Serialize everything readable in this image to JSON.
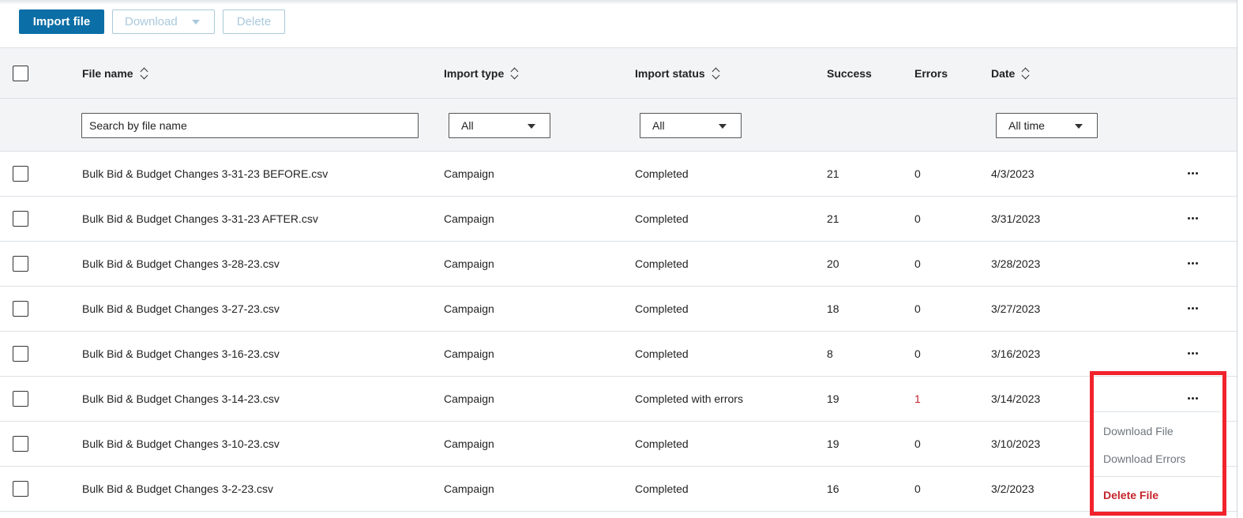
{
  "toolbar": {
    "import_label": "Import file",
    "download_label": "Download",
    "delete_label": "Delete"
  },
  "columns": {
    "file_name": "File name",
    "import_type": "Import type",
    "import_status": "Import status",
    "success": "Success",
    "errors": "Errors",
    "date": "Date"
  },
  "filters": {
    "search_placeholder": "Search by file name",
    "import_type_value": "All",
    "import_status_value": "All",
    "date_value": "All time"
  },
  "rows": [
    {
      "file": "Bulk Bid & Budget Changes 3-31-23 BEFORE.csv",
      "type": "Campaign",
      "status": "Completed",
      "success": "21",
      "errors": "0",
      "date": "4/3/2023"
    },
    {
      "file": "Bulk Bid & Budget Changes 3-31-23 AFTER.csv",
      "type": "Campaign",
      "status": "Completed",
      "success": "21",
      "errors": "0",
      "date": "3/31/2023"
    },
    {
      "file": "Bulk Bid & Budget Changes 3-28-23.csv",
      "type": "Campaign",
      "status": "Completed",
      "success": "20",
      "errors": "0",
      "date": "3/28/2023"
    },
    {
      "file": "Bulk Bid & Budget Changes 3-27-23.csv",
      "type": "Campaign",
      "status": "Completed",
      "success": "18",
      "errors": "0",
      "date": "3/27/2023"
    },
    {
      "file": "Bulk Bid & Budget Changes 3-16-23.csv",
      "type": "Campaign",
      "status": "Completed",
      "success": "8",
      "errors": "0",
      "date": "3/16/2023"
    },
    {
      "file": "Bulk Bid & Budget Changes 3-14-23.csv",
      "type": "Campaign",
      "status": "Completed with errors",
      "success": "19",
      "errors": "1",
      "date": "3/14/2023"
    },
    {
      "file": "Bulk Bid & Budget Changes 3-10-23.csv",
      "type": "Campaign",
      "status": "Completed",
      "success": "19",
      "errors": "0",
      "date": "3/10/2023"
    },
    {
      "file": "Bulk Bid & Budget Changes 3-2-23.csv",
      "type": "Campaign",
      "status": "Completed",
      "success": "16",
      "errors": "0",
      "date": "3/2/2023"
    }
  ],
  "menu": {
    "download_file": "Download File",
    "download_errors": "Download Errors",
    "delete_file": "Delete File"
  },
  "colors": {
    "primary": "#0b6ea6",
    "error": "#c4232b",
    "highlight": "#f1232c"
  }
}
